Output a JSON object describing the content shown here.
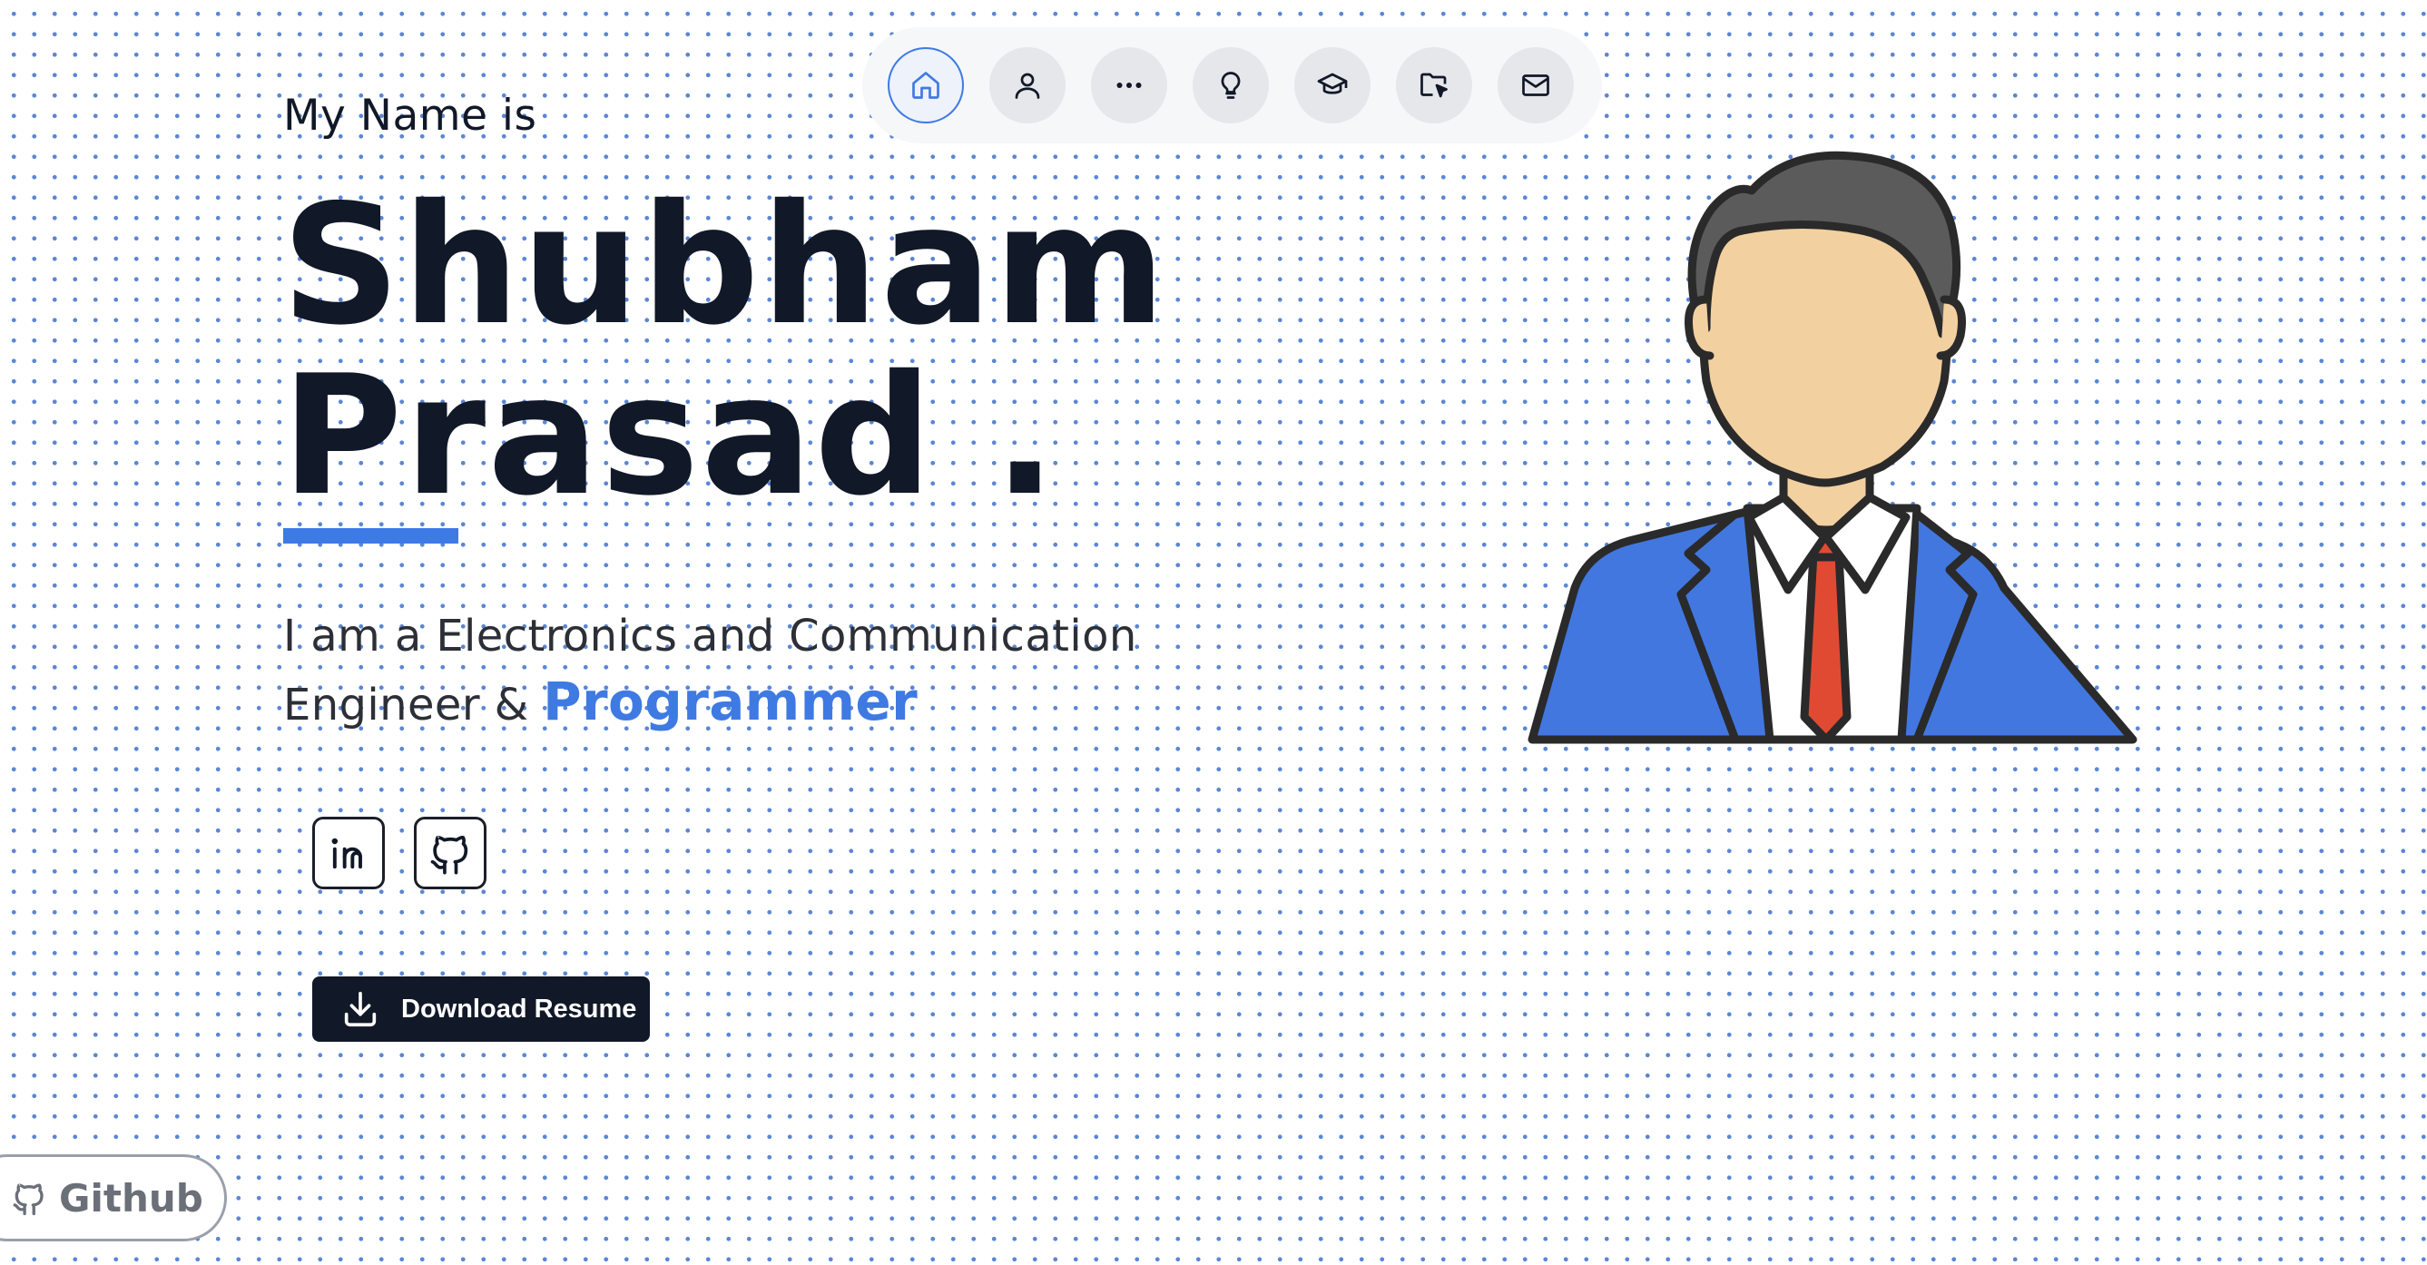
{
  "nav": {
    "items": [
      {
        "icon": "home-icon",
        "active": true
      },
      {
        "icon": "user-icon",
        "active": false
      },
      {
        "icon": "ellipsis-icon",
        "active": false
      },
      {
        "icon": "lightbulb-icon",
        "active": false
      },
      {
        "icon": "graduation-cap-icon",
        "active": false
      },
      {
        "icon": "folder-cursor-icon",
        "active": false
      },
      {
        "icon": "mail-icon",
        "active": false
      }
    ]
  },
  "hero": {
    "intro": "My Name is",
    "first_name": "Shubham",
    "last_name": "Prasad .",
    "tagline_line1": "I am a Electronics and Communication",
    "tagline_line2": "Engineer & ",
    "tagline_highlight": "Programmer"
  },
  "socials": [
    {
      "icon": "linkedin-icon"
    },
    {
      "icon": "github-icon"
    }
  ],
  "download_button": {
    "label": "Download Resume",
    "icon": "download-icon"
  },
  "github_float": {
    "label": "Github",
    "icon": "github-icon"
  },
  "colors": {
    "accent": "#3f7ae3",
    "text_dark": "#111827",
    "button_bg": "#111827",
    "dot_grid": "#5a86d6",
    "suit": "#4277e0",
    "tie": "#e04a33",
    "skin": "#f3d0a0",
    "hair": "#5b5b5b"
  }
}
